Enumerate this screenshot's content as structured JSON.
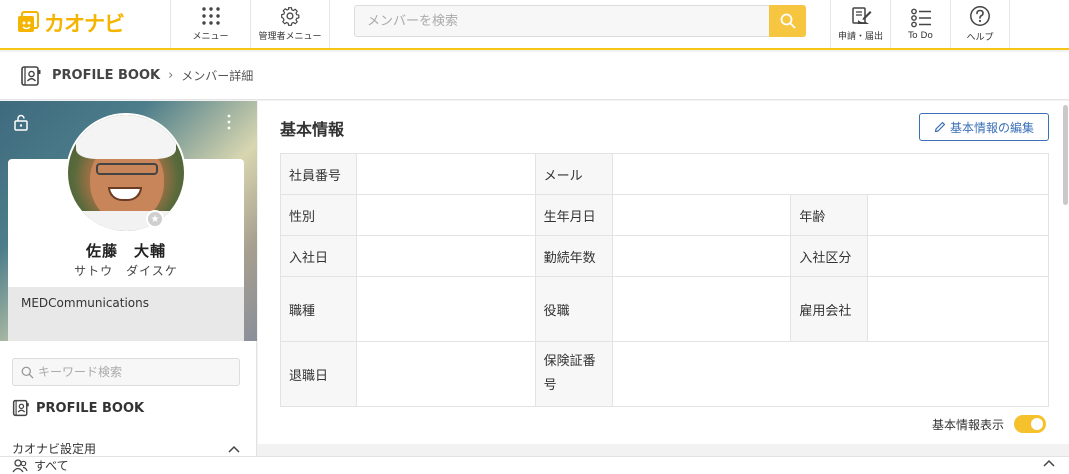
{
  "header": {
    "logo_text": "カオナビ",
    "brand_color": "#f5b400",
    "nav": [
      {
        "id": "menu",
        "label": "メニュー",
        "icon": "grid-icon"
      },
      {
        "id": "admin",
        "label": "管理者メニュー",
        "icon": "gear-icon"
      }
    ],
    "search": {
      "placeholder": "メンバーを検索"
    },
    "actions": [
      {
        "id": "apply",
        "label": "申請・届出",
        "icon": "request-icon"
      },
      {
        "id": "todo",
        "label": "To Do",
        "icon": "checklist-icon"
      },
      {
        "id": "help",
        "label": "ヘルプ",
        "icon": "help-icon"
      }
    ]
  },
  "breadcrumb": {
    "title": "PROFILE BOOK",
    "separator": "›",
    "current": "メンバー詳細"
  },
  "profile": {
    "name": "佐藤　大輔",
    "kana": "サトウ　ダイスケ",
    "company": "MEDCommunications"
  },
  "sidebar": {
    "keyword_placeholder": "キーワード検索",
    "section_title": "PROFILE BOOK",
    "group_label": "カオナビ設定用",
    "bottom_label": "すべて"
  },
  "main": {
    "title": "基本情報",
    "edit_button": "基本情報の編集",
    "fields": {
      "employee_no": "社員番号",
      "email": "メール",
      "gender": "性別",
      "birthday": "生年月日",
      "age": "年齢",
      "join_date": "入社日",
      "years": "勤続年数",
      "join_type": "入社区分",
      "job_type": "職種",
      "position": "役職",
      "employer": "雇用会社",
      "leave_date": "退職日",
      "insurance_no": "保険証番号"
    },
    "toggle_label": "基本情報表示",
    "toggle_on": true,
    "accent_color": "#f5c22e"
  }
}
